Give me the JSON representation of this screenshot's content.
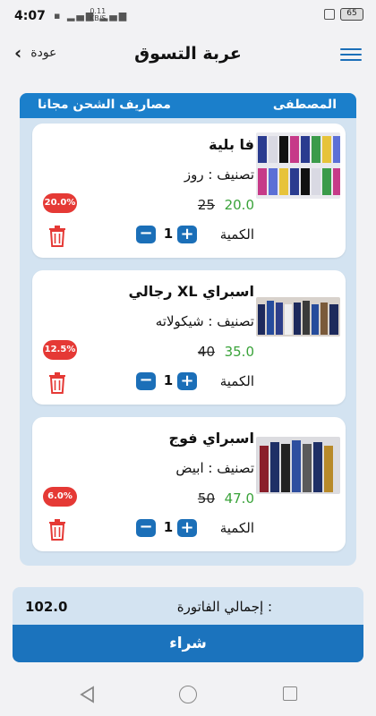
{
  "status_bar": {
    "time": "4:07",
    "net_speed": "0.11",
    "net_unit": "KB/S",
    "battery": "65"
  },
  "header": {
    "back_label": "عودة",
    "title": "عربة التسوق"
  },
  "panel": {
    "shipping_text": "مصاريف الشحن مجانا",
    "owner_name": "المصطفى"
  },
  "items": [
    {
      "name": "فا بلية",
      "category": "تصنيف : روز",
      "price_new": "20.0",
      "price_old": "25",
      "discount": "20.0%",
      "qty_label": "الكمية",
      "qty": "1"
    },
    {
      "name": "اسبراي XL رجالي",
      "category": "تصنيف : شيكولاته",
      "price_new": "35.0",
      "price_old": "40",
      "discount": "12.5%",
      "qty_label": "الكمية",
      "qty": "1"
    },
    {
      "name": "اسبراي فوج",
      "category": "تصنيف : ابيض",
      "price_new": "47.0",
      "price_old": "50",
      "discount": "6.0%",
      "qty_label": "الكمية",
      "qty": "1"
    }
  ],
  "footer": {
    "total_label": "إجمالي الفاتورة :",
    "total_value": "102.0",
    "buy_label": "شراء"
  },
  "colors": {
    "primary": "#1b73bd",
    "header_bar": "#1b7fcb",
    "panel_bg": "#d3e3f1",
    "price_green": "#3aa33a",
    "badge_red": "#e53935"
  }
}
